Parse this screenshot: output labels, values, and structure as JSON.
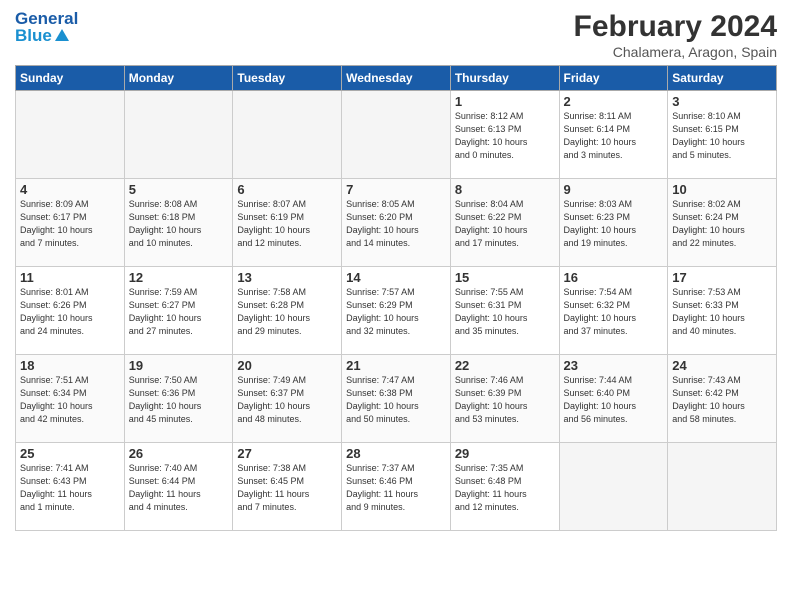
{
  "header": {
    "title": "February 2024",
    "subtitle": "Chalamera, Aragon, Spain",
    "logo_general": "General",
    "logo_blue": "Blue"
  },
  "calendar": {
    "weekdays": [
      "Sunday",
      "Monday",
      "Tuesday",
      "Wednesday",
      "Thursday",
      "Friday",
      "Saturday"
    ],
    "weeks": [
      [
        {
          "day": "",
          "detail": ""
        },
        {
          "day": "",
          "detail": ""
        },
        {
          "day": "",
          "detail": ""
        },
        {
          "day": "",
          "detail": ""
        },
        {
          "day": "1",
          "detail": "Sunrise: 8:12 AM\nSunset: 6:13 PM\nDaylight: 10 hours\nand 0 minutes."
        },
        {
          "day": "2",
          "detail": "Sunrise: 8:11 AM\nSunset: 6:14 PM\nDaylight: 10 hours\nand 3 minutes."
        },
        {
          "day": "3",
          "detail": "Sunrise: 8:10 AM\nSunset: 6:15 PM\nDaylight: 10 hours\nand 5 minutes."
        }
      ],
      [
        {
          "day": "4",
          "detail": "Sunrise: 8:09 AM\nSunset: 6:17 PM\nDaylight: 10 hours\nand 7 minutes."
        },
        {
          "day": "5",
          "detail": "Sunrise: 8:08 AM\nSunset: 6:18 PM\nDaylight: 10 hours\nand 10 minutes."
        },
        {
          "day": "6",
          "detail": "Sunrise: 8:07 AM\nSunset: 6:19 PM\nDaylight: 10 hours\nand 12 minutes."
        },
        {
          "day": "7",
          "detail": "Sunrise: 8:05 AM\nSunset: 6:20 PM\nDaylight: 10 hours\nand 14 minutes."
        },
        {
          "day": "8",
          "detail": "Sunrise: 8:04 AM\nSunset: 6:22 PM\nDaylight: 10 hours\nand 17 minutes."
        },
        {
          "day": "9",
          "detail": "Sunrise: 8:03 AM\nSunset: 6:23 PM\nDaylight: 10 hours\nand 19 minutes."
        },
        {
          "day": "10",
          "detail": "Sunrise: 8:02 AM\nSunset: 6:24 PM\nDaylight: 10 hours\nand 22 minutes."
        }
      ],
      [
        {
          "day": "11",
          "detail": "Sunrise: 8:01 AM\nSunset: 6:26 PM\nDaylight: 10 hours\nand 24 minutes."
        },
        {
          "day": "12",
          "detail": "Sunrise: 7:59 AM\nSunset: 6:27 PM\nDaylight: 10 hours\nand 27 minutes."
        },
        {
          "day": "13",
          "detail": "Sunrise: 7:58 AM\nSunset: 6:28 PM\nDaylight: 10 hours\nand 29 minutes."
        },
        {
          "day": "14",
          "detail": "Sunrise: 7:57 AM\nSunset: 6:29 PM\nDaylight: 10 hours\nand 32 minutes."
        },
        {
          "day": "15",
          "detail": "Sunrise: 7:55 AM\nSunset: 6:31 PM\nDaylight: 10 hours\nand 35 minutes."
        },
        {
          "day": "16",
          "detail": "Sunrise: 7:54 AM\nSunset: 6:32 PM\nDaylight: 10 hours\nand 37 minutes."
        },
        {
          "day": "17",
          "detail": "Sunrise: 7:53 AM\nSunset: 6:33 PM\nDaylight: 10 hours\nand 40 minutes."
        }
      ],
      [
        {
          "day": "18",
          "detail": "Sunrise: 7:51 AM\nSunset: 6:34 PM\nDaylight: 10 hours\nand 42 minutes."
        },
        {
          "day": "19",
          "detail": "Sunrise: 7:50 AM\nSunset: 6:36 PM\nDaylight: 10 hours\nand 45 minutes."
        },
        {
          "day": "20",
          "detail": "Sunrise: 7:49 AM\nSunset: 6:37 PM\nDaylight: 10 hours\nand 48 minutes."
        },
        {
          "day": "21",
          "detail": "Sunrise: 7:47 AM\nSunset: 6:38 PM\nDaylight: 10 hours\nand 50 minutes."
        },
        {
          "day": "22",
          "detail": "Sunrise: 7:46 AM\nSunset: 6:39 PM\nDaylight: 10 hours\nand 53 minutes."
        },
        {
          "day": "23",
          "detail": "Sunrise: 7:44 AM\nSunset: 6:40 PM\nDaylight: 10 hours\nand 56 minutes."
        },
        {
          "day": "24",
          "detail": "Sunrise: 7:43 AM\nSunset: 6:42 PM\nDaylight: 10 hours\nand 58 minutes."
        }
      ],
      [
        {
          "day": "25",
          "detail": "Sunrise: 7:41 AM\nSunset: 6:43 PM\nDaylight: 11 hours\nand 1 minute."
        },
        {
          "day": "26",
          "detail": "Sunrise: 7:40 AM\nSunset: 6:44 PM\nDaylight: 11 hours\nand 4 minutes."
        },
        {
          "day": "27",
          "detail": "Sunrise: 7:38 AM\nSunset: 6:45 PM\nDaylight: 11 hours\nand 7 minutes."
        },
        {
          "day": "28",
          "detail": "Sunrise: 7:37 AM\nSunset: 6:46 PM\nDaylight: 11 hours\nand 9 minutes."
        },
        {
          "day": "29",
          "detail": "Sunrise: 7:35 AM\nSunset: 6:48 PM\nDaylight: 11 hours\nand 12 minutes."
        },
        {
          "day": "",
          "detail": ""
        },
        {
          "day": "",
          "detail": ""
        }
      ]
    ]
  }
}
